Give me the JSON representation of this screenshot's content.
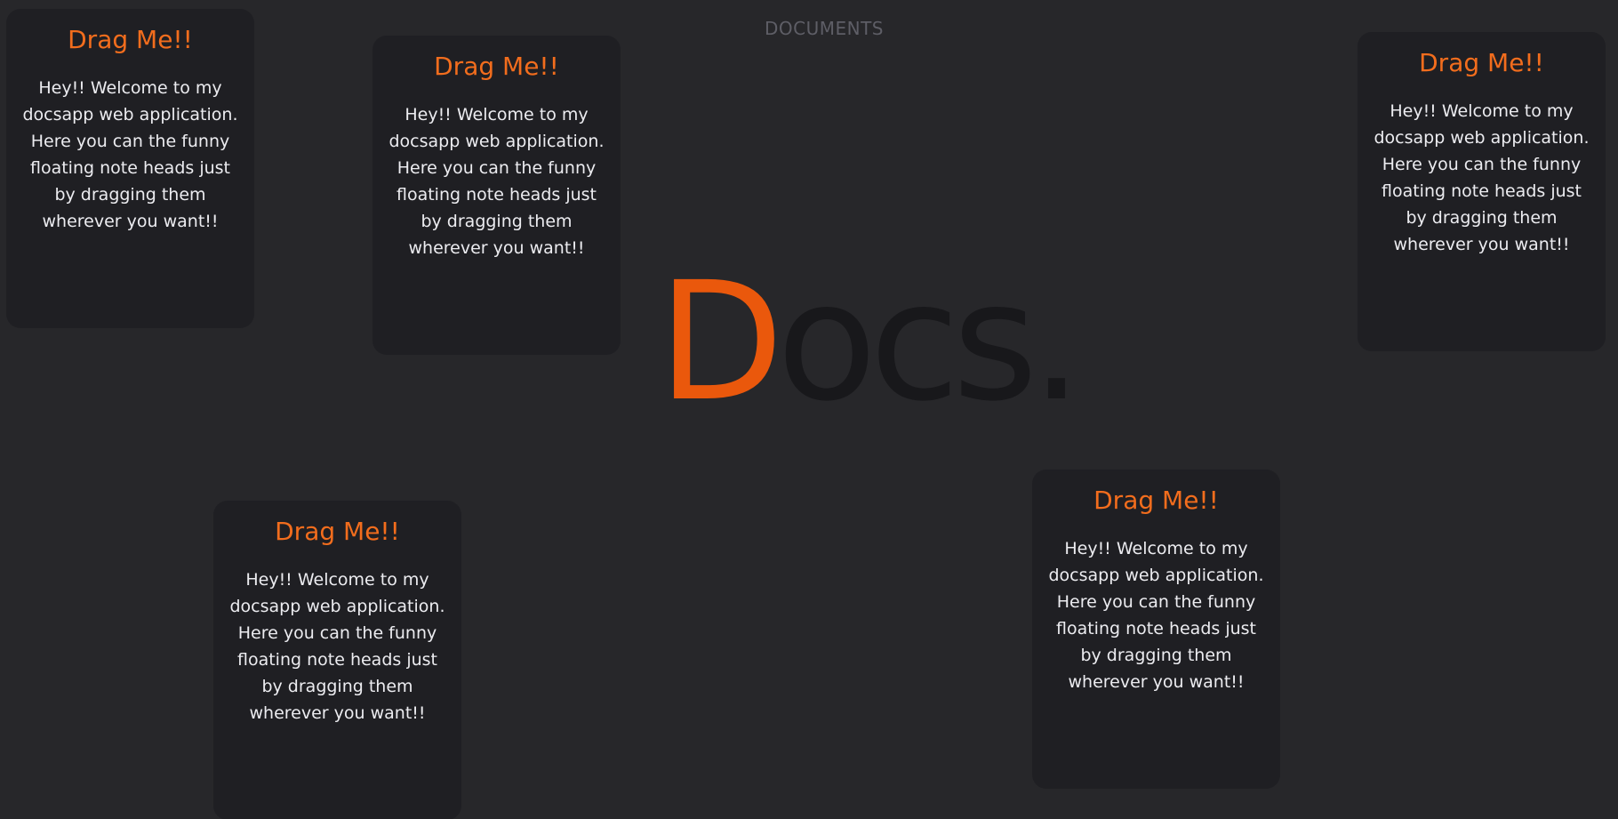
{
  "header": {
    "label": "DOCUMENTS"
  },
  "logo": {
    "accent_letter": "D",
    "rest": "ocs.",
    "colors": {
      "accent": "#ea580c",
      "rest": "#18181b"
    }
  },
  "cards": [
    {
      "title": "Drag Me!!",
      "body": "Hey!! Welcome to my docsapp web application. Here you can the funny floating note heads just by dragging them wherever you want!!"
    },
    {
      "title": "Drag Me!!",
      "body": "Hey!! Welcome to my docsapp web application. Here you can the funny floating note heads just by dragging them wherever you want!!"
    },
    {
      "title": "Drag Me!!",
      "body": "Hey!! Welcome to my docsapp web application. Here you can the funny floating note heads just by dragging them wherever you want!!"
    },
    {
      "title": "Drag Me!!",
      "body": "Hey!! Welcome to my docsapp web application. Here you can the funny floating note heads just by dragging them wherever you want!!"
    },
    {
      "title": "Drag Me!!",
      "body": "Hey!! Welcome to my docsapp web application. Here you can the funny floating note heads just by dragging them wherever you want!!"
    }
  ],
  "colors": {
    "background": "#27272a",
    "card_background": "#1f1f23",
    "title_accent": "#f26d1d",
    "header_text": "#5e5e66"
  }
}
